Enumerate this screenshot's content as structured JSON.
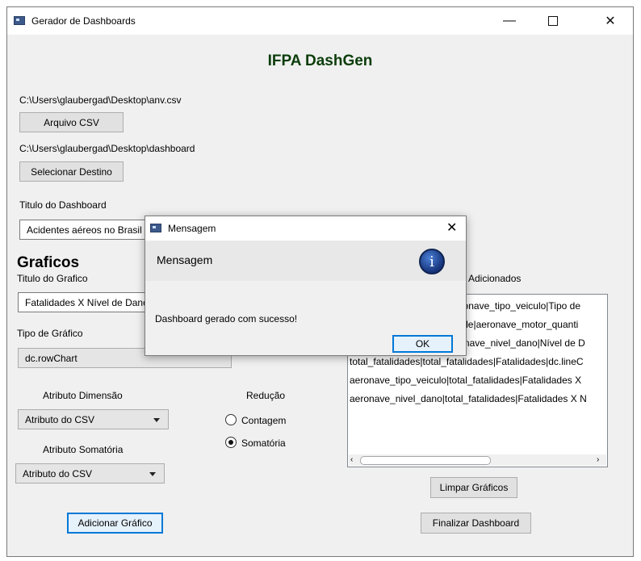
{
  "window": {
    "title": "Gerador de Dashboards"
  },
  "app_title": "IFPA DashGen",
  "csv": {
    "path": "C:\\Users\\glaubergad\\Desktop\\anv.csv",
    "button_label": "Arquivo CSV"
  },
  "dest": {
    "path": "C:\\Users\\glaubergad\\Desktop\\dashboard",
    "button_label": "Selecionar Destino"
  },
  "dashboard_title": {
    "label": "Titulo do Dashboard",
    "value": "Acidentes aéreos no Brasil"
  },
  "graficos": {
    "heading": "Graficos",
    "title_label": "Titulo do Grafico",
    "title_value": "Fatalidades X Nível de Dano",
    "type_label": "Tipo de Gráfico",
    "type_value": "dc.rowChart",
    "dim_label": "Atributo Dimensão",
    "dim_value": "Atributo do CSV",
    "sum_label": "Atributo Somatória",
    "sum_value": "Atributo do CSV",
    "reduction_label": "Redução",
    "radio_count": "Contagem",
    "radio_sum": "Somatória",
    "add_button": "Adicionar Gráfico"
  },
  "added": {
    "label": "Adicionados",
    "items": [
      "aeronave_tipo_veiculo|aeronave_tipo_veiculo|Tipo de",
      "aeronave_motor_quantidade|aeronave_motor_quanti",
      "aeronave_nivel_dano|aeronave_nivel_dano|Nível de D",
      "total_fatalidades|total_fatalidades|Fatalidades|dc.lineC",
      "aeronave_tipo_veiculo|total_fatalidades|Fatalidades X",
      "aeronave_nivel_dano|total_fatalidades|Fatalidades X N"
    ],
    "clear_button": "Limpar Gráficos",
    "finish_button": "Finalizar Dashboard"
  },
  "dialog": {
    "title": "Mensagem",
    "header": "Mensagem",
    "message": "Dashboard gerado com sucesso!",
    "ok_label": "OK",
    "icon": "info-icon"
  },
  "colors": {
    "title_green": "#0a3d0a",
    "focus_blue": "#0078d7"
  }
}
